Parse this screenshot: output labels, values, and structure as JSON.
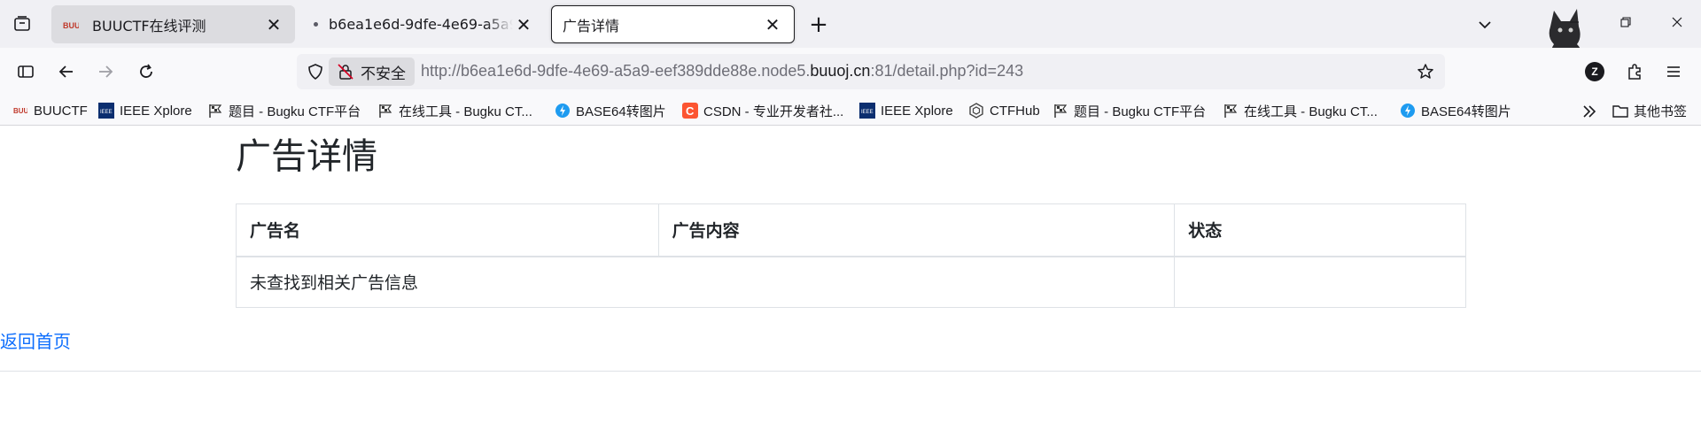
{
  "browser": {
    "tabs": [
      {
        "title": "BUUCTF在线评测",
        "active": false
      },
      {
        "title": "b6ea1e6d-9dfe-4e69-a5a9-eef389dde88e",
        "active": false
      },
      {
        "title": "广告详情",
        "active": true
      }
    ],
    "new_tab_label": "+",
    "security_label": "不安全",
    "url_prefix": "http://b6ea1e6d-9dfe-4e69-a5a9-eef389dde88e.node5.",
    "url_host": "buuoj.cn",
    "url_suffix": ":81/detail.php?id=243",
    "profile_badge": "Z",
    "bookmarks": [
      {
        "label": "BUUCTF",
        "icon": "buuctf-icon"
      },
      {
        "label": "IEEE Xplore",
        "icon": "ieee-icon"
      },
      {
        "label": "题目 - Bugku CTF平台",
        "icon": "bugku-flag-icon"
      },
      {
        "label": "在线工具 - Bugku CT...",
        "icon": "bugku-flag-icon"
      },
      {
        "label": "BASE64转图片",
        "icon": "base64-icon"
      },
      {
        "label": "CSDN - 专业开发者社...",
        "icon": "csdn-icon"
      },
      {
        "label": "IEEE Xplore",
        "icon": "ieee-icon"
      },
      {
        "label": "CTFHub",
        "icon": "ctfhub-icon"
      },
      {
        "label": "题目 - Bugku CTF平台",
        "icon": "bugku-flag-icon"
      },
      {
        "label": "在线工具 - Bugku CT...",
        "icon": "bugku-flag-icon"
      },
      {
        "label": "BASE64转图片",
        "icon": "base64-icon"
      }
    ],
    "other_bookmarks": "其他书签"
  },
  "page": {
    "title": "广告详情",
    "table": {
      "headers": [
        "广告名",
        "广告内容",
        "状态"
      ],
      "rows": [
        [
          "未查找到相关广告信息",
          "",
          ""
        ]
      ]
    },
    "back_link": "返回首页"
  },
  "colors": {
    "link": "#0d6efd",
    "text": "#212529",
    "border": "#dee2e6",
    "chrome": "#f0f0f4"
  }
}
